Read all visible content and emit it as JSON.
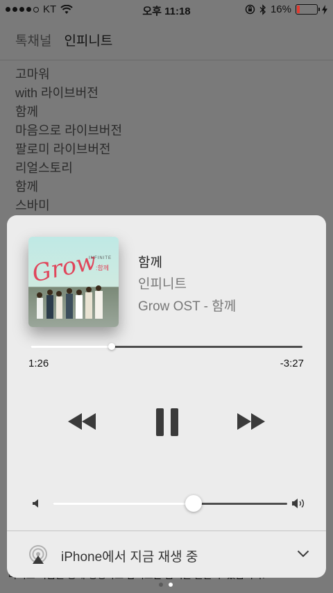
{
  "status_bar": {
    "carrier": "KT",
    "time": "오후 11:18",
    "battery_text": "16%",
    "battery_level": 0.16,
    "battery_color": "#e23a2f"
  },
  "background": {
    "header": {
      "back_label": "톡채널",
      "title": "인피니트"
    },
    "items": [
      "고마워",
      "with 라이브버전",
      "함께",
      "마음으로 라이브버전",
      "팔로미 라이브버전",
      "리얼스토리",
      "함께",
      "스바미"
    ],
    "footer_text": "라이브 녹음을 통해 생생하고 감미로운 음색을 들을 수 있습니다."
  },
  "player": {
    "album_art": {
      "title_art": "Grow",
      "brand": "INFINITE",
      "sub": ":함께"
    },
    "track_title": "함께",
    "artist": "인피니트",
    "album": "Grow OST - 함께",
    "elapsed": "1:26",
    "remaining": "-3:27",
    "progress": 0.298,
    "volume": 0.6,
    "controls": {
      "rewind_icon": "rewind-icon",
      "pause_icon": "pause-icon",
      "forward_icon": "fast-forward-icon"
    },
    "airplay_label": "iPhone에서 지금 재생 중"
  },
  "pager": {
    "pages": 2,
    "current": 2
  }
}
